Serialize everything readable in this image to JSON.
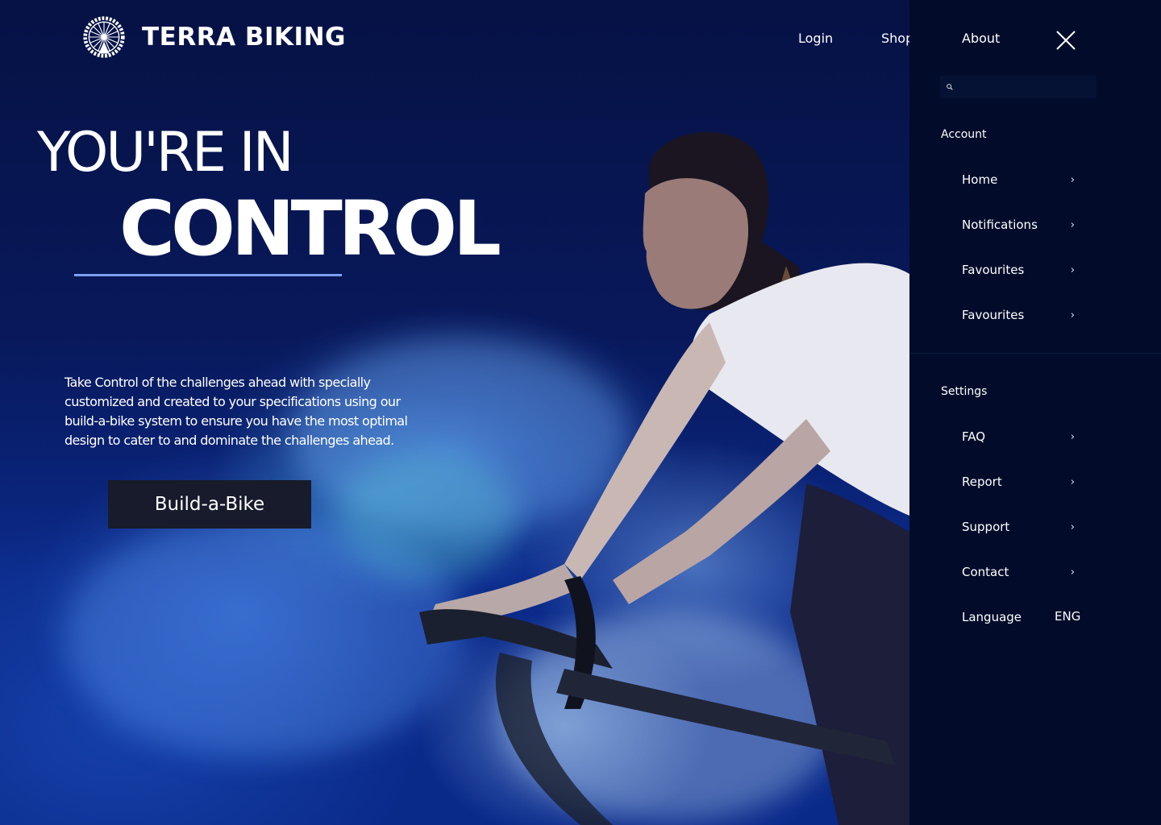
{
  "brand": {
    "name": "TERRA BIKING"
  },
  "nav": {
    "login": "Login",
    "shop": "Shop",
    "about": "About"
  },
  "hero": {
    "headline_line1": "YOU'RE IN",
    "headline_line2": "CONTROL",
    "body": "Take Control of the challenges ahead with specially customized and created to your specifications using our build-a-bike system to ensure you have the most optimal design to cater to and dominate the challenges ahead.",
    "cta_label": "Build-a-Bike"
  },
  "menu": {
    "search_placeholder": "",
    "account_title": "Account",
    "account_items": [
      "Home",
      "Notifications",
      "Favourites",
      "Favourites"
    ],
    "settings_title": "Settings",
    "settings_items": [
      "FAQ",
      "Report",
      "Support",
      "Contact"
    ],
    "language_label": "Language",
    "language_value": "ENG"
  },
  "colors": {
    "page_bg": "#040f3a",
    "panel_bg": "#020c2a",
    "accent_rule": "#7a9ff0",
    "button_bg": "#171b2b"
  }
}
